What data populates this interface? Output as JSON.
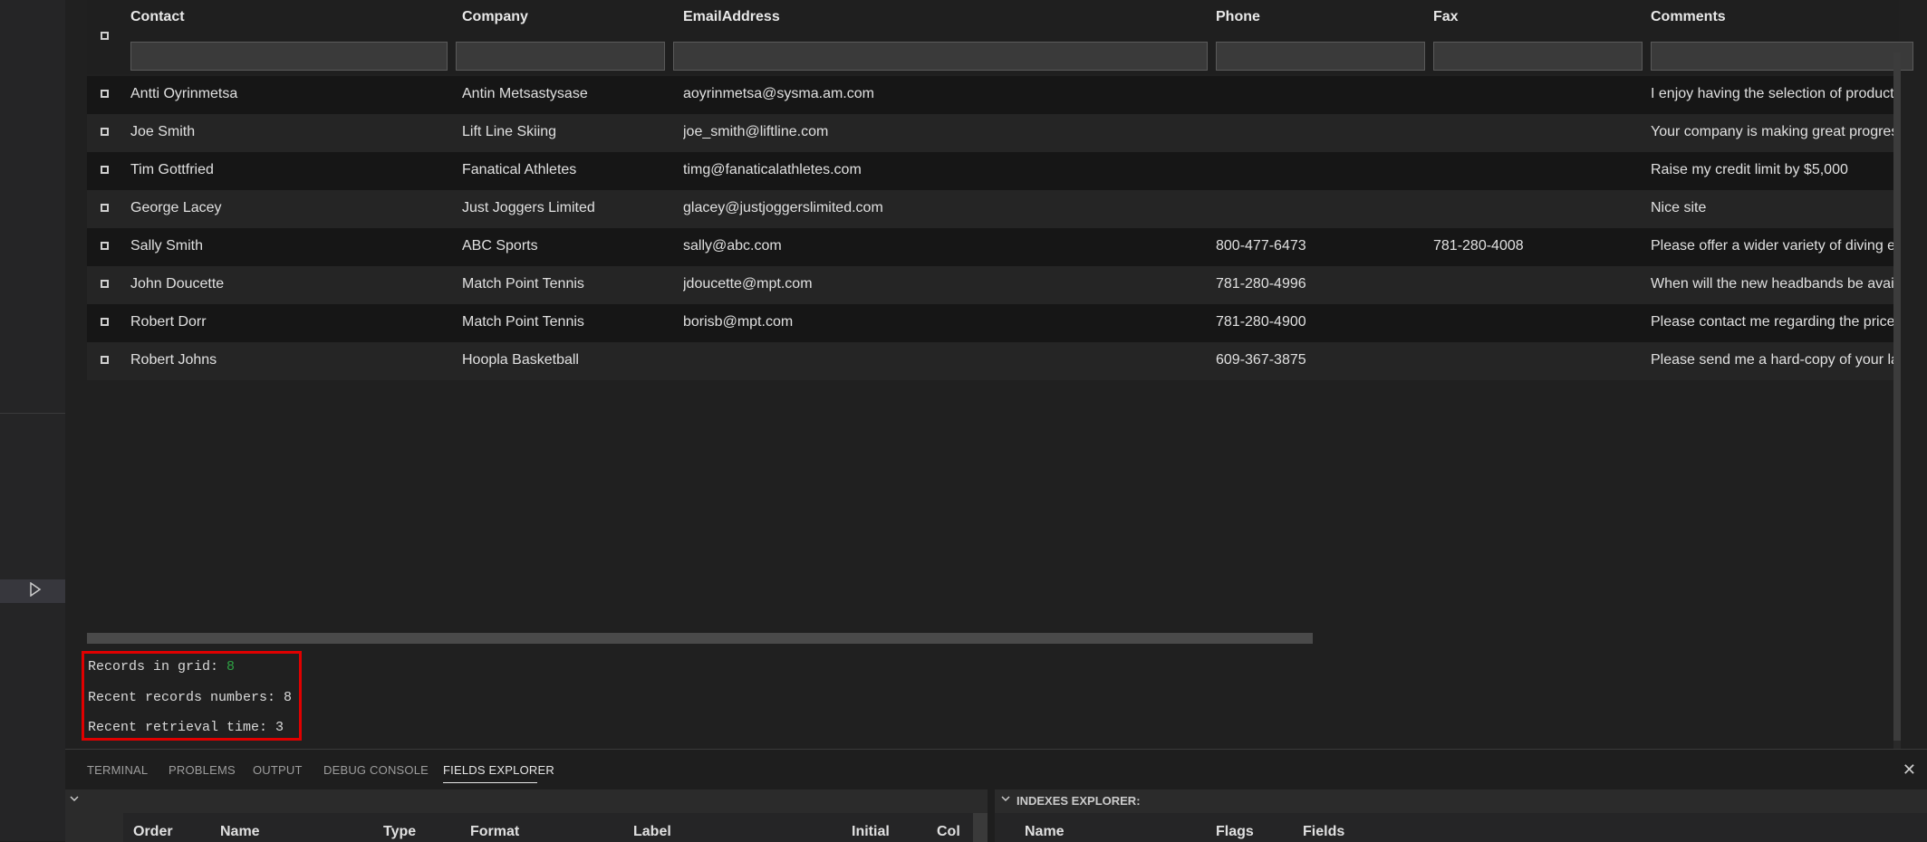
{
  "grid": {
    "columns": [
      "Contact",
      "Company",
      "EmailAddress",
      "Phone",
      "Fax",
      "Comments"
    ],
    "rows": [
      {
        "contact": "Antti Oyrinmetsa",
        "company": "Antin Metsastysase",
        "email": "aoyrinmetsa@sysma.am.com",
        "phone": "",
        "fax": "",
        "comments": "I enjoy having the selection of products"
      },
      {
        "contact": "Joe Smith",
        "company": "Lift Line Skiing",
        "email": "joe_smith@liftline.com",
        "phone": "",
        "fax": "",
        "comments": "Your company is making great progress"
      },
      {
        "contact": "Tim Gottfried",
        "company": "Fanatical Athletes",
        "email": "timg@fanaticalathletes.com",
        "phone": "",
        "fax": "",
        "comments": "Raise my credit limit by $5,000"
      },
      {
        "contact": "George Lacey",
        "company": "Just Joggers Limited",
        "email": "glacey@justjoggerslimited.com",
        "phone": "",
        "fax": "",
        "comments": "Nice site"
      },
      {
        "contact": "Sally Smith",
        "company": "ABC Sports",
        "email": "sally@abc.com",
        "phone": "800-477-6473",
        "fax": "781-280-4008",
        "comments": "Please offer a wider variety of diving equ"
      },
      {
        "contact": "John Doucette",
        "company": "Match Point Tennis",
        "email": "jdoucette@mpt.com",
        "phone": "781-280-4996",
        "fax": "",
        "comments": "When will the new headbands be availal"
      },
      {
        "contact": "Robert Dorr",
        "company": "Match Point Tennis",
        "email": "borisb@mpt.com",
        "phone": "781-280-4900",
        "fax": "",
        "comments": "Please contact me regarding the price o"
      },
      {
        "contact": "Robert Johns",
        "company": "Hoopla Basketball",
        "email": "",
        "phone": "609-367-3875",
        "fax": "",
        "comments": "Please send me a hard-copy of your late"
      }
    ]
  },
  "stats": {
    "records_label": "Records in grid: ",
    "records_value": "8",
    "recent_label": "Recent records numbers: 8",
    "retrieval_label": "Recent retrieval time: 3"
  },
  "panel": {
    "tabs": [
      "TERMINAL",
      "PROBLEMS",
      "OUTPUT",
      "DEBUG CONSOLE",
      "FIELDS EXPLORER"
    ],
    "active_tab": "FIELDS EXPLORER",
    "fields_columns": [
      "Order",
      "Name",
      "Type",
      "Format",
      "Label",
      "Initial",
      "Col"
    ],
    "indexes_title": "INDEXES EXPLORER:",
    "indexes_columns": [
      "Name",
      "Flags",
      "Fields"
    ]
  },
  "icons": {
    "run": "play-icon",
    "close": "close-icon",
    "collapse": "chevron-down-icon"
  },
  "colors": {
    "highlight_border": "#e00000",
    "records_value": "#2ea043"
  }
}
